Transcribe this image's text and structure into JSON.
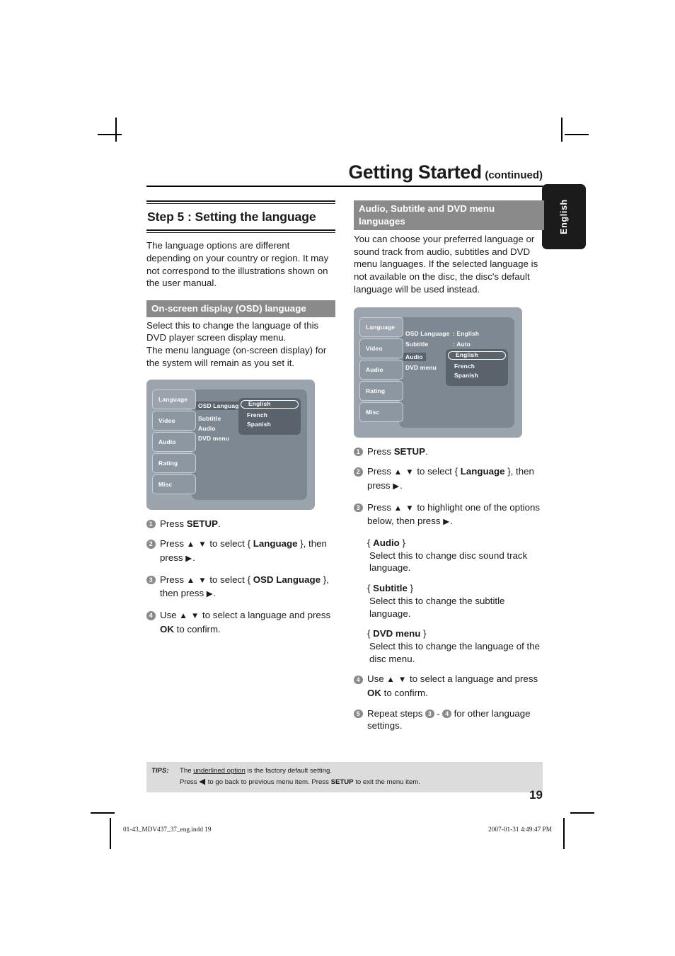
{
  "header": {
    "title": "Getting Started",
    "suffix": "(continued)"
  },
  "side_tab": {
    "label": "English"
  },
  "left_column": {
    "step_title": "Step 5 : Setting the language",
    "intro": "The language options are different depending on your country or region. It may not correspond to the illustrations shown on the user manual.",
    "section_bar": "On-screen display (OSD) language",
    "section_body_1": "Select this to change the language of this DVD player screen display menu.",
    "section_body_2": "The menu language (on-screen display) for the system will remain as you set it.",
    "menu_shot": {
      "tabs": [
        "Language",
        "Video",
        "Audio",
        "Rating",
        "Misc"
      ],
      "items": [
        "OSD Language",
        "Subtitle",
        "Audio",
        "DVD menu"
      ],
      "selected_item": "OSD Language",
      "options": [
        "English",
        "French",
        "Spanish"
      ],
      "highlighted_option": "English"
    },
    "steps": [
      {
        "n": "1",
        "html": "Press <b>SETUP</b>."
      },
      {
        "n": "2",
        "html": "Press <span class=\"arrow\">▲ ▼</span> to select { <b>Language</b> }, then press <span class=\"arrow\">▶</span>."
      },
      {
        "n": "3",
        "html": "Press <span class=\"arrow\">▲ ▼</span> to select { <b>OSD Language</b> }, then press <span class=\"arrow\">▶</span>."
      },
      {
        "n": "4",
        "html": "Use <span class=\"arrow\">▲ ▼</span> to select a language and press <b>OK</b> to confirm."
      }
    ]
  },
  "right_column": {
    "section_bar": "Audio, Subtitle and DVD menu languages",
    "section_body": "You can choose your preferred language or sound track from audio, subtitles and DVD menu languages. If the selected language is not available on the disc, the disc's default language will be used instead.",
    "menu_shot": {
      "tabs": [
        "Language",
        "Video",
        "Audio",
        "Rating",
        "Misc"
      ],
      "items": [
        "OSD Language",
        "Subtitle",
        "Audio",
        "DVD menu"
      ],
      "values": [
        ": English",
        ": Auto"
      ],
      "selected_item": "Audio",
      "options": [
        "English",
        "French",
        "Spanish"
      ],
      "highlighted_option": "English"
    },
    "steps": [
      {
        "n": "1",
        "html": "Press <b>SETUP</b>."
      },
      {
        "n": "2",
        "html": "Press <span class=\"arrow\">▲ ▼</span> to select { <b>Language</b> }, then press <span class=\"arrow\">▶</span>."
      },
      {
        "n": "3",
        "html": "Press <span class=\"arrow\">▲ ▼</span> to highlight one of the options below, then press <span class=\"arrow\">▶</span>."
      }
    ],
    "sub_options": [
      {
        "name": "Audio",
        "desc": "Select this to change disc sound track language."
      },
      {
        "name": "Subtitle",
        "desc": "Select this to change the subtitle language."
      },
      {
        "name": "DVD menu",
        "desc": "Select this to change the language of the disc menu."
      }
    ],
    "steps_tail": [
      {
        "n": "4",
        "html": "Use <span class=\"arrow\">▲ ▼</span> to select a language and press <b>OK</b> to confirm."
      },
      {
        "n": "5",
        "html": "Repeat steps <span class=\"num-inline\">3</span> - <span class=\"num-inline\">4</span> for other language settings."
      }
    ]
  },
  "tips": {
    "label": "TIPS:",
    "line1_pre": "The ",
    "line1_underlined": "underlined option",
    "line1_post": " is the factory default setting.",
    "line2_html": "Press <span class=\"arrow\">◀</span> to go back to previous menu item. Press <b>SETUP</b> to exit the menu item."
  },
  "page_number": "19",
  "footer": {
    "file": "01-43_MDV437_37_eng.indd   19",
    "timestamp": "2007-01-31   4:49:47 PM"
  },
  "colors": {
    "grey_bar": "#8a8a8a",
    "tips_bg": "#dcdcdc",
    "tv_outer": "#9ba3ad",
    "tv_inner": "#7d8892",
    "tv_dropdown": "#5a626c",
    "tab_dark": "#1b1b1b"
  }
}
